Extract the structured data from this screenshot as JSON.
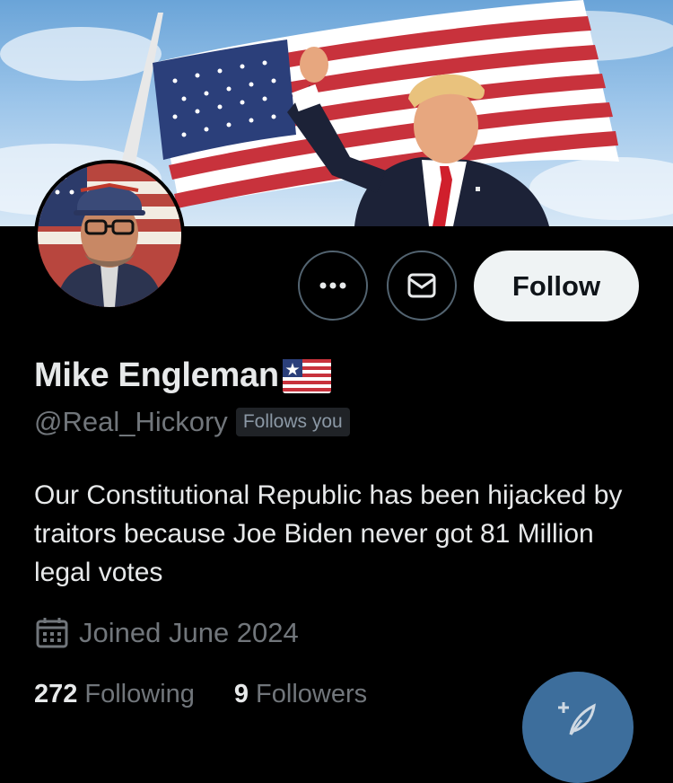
{
  "header": {
    "banner_image": "american-flag-with-man-fist-raised",
    "avatar_image": "man-with-cap-and-glasses"
  },
  "actions": {
    "more_icon": "ellipsis-icon",
    "message_icon": "envelope-icon",
    "follow_label": "Follow"
  },
  "profile": {
    "name": "Mike Engleman",
    "name_emoji": "flag-emoji",
    "handle": "@Real_Hickory",
    "follows_badge": "Follows you",
    "bio": "Our Constitutional Republic has been hijacked by traitors because Joe Biden never got 81 Million legal votes",
    "joined": "Joined June 2024"
  },
  "stats": {
    "following_count": "272",
    "following_label": "Following",
    "followers_count": "9",
    "followers_label": "Followers"
  },
  "fab": {
    "icon": "compose-post-icon"
  },
  "colors": {
    "background": "#000000",
    "primary_text": "#e7e9ea",
    "secondary_text": "#71767b",
    "follow_button_bg": "#eff3f4",
    "fab_bg": "#3d6e9c"
  }
}
